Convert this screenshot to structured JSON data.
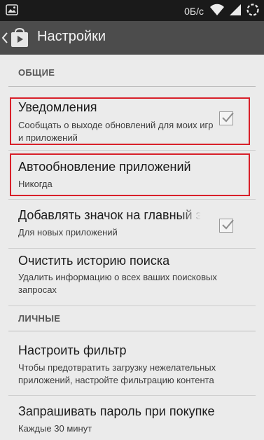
{
  "status_bar": {
    "data_rate": "0Б/с",
    "icons": [
      "image-icon",
      "wifi-icon",
      "signal-icon"
    ]
  },
  "action_bar": {
    "title": "Настройки",
    "icons": [
      "back-icon",
      "play-store-icon"
    ]
  },
  "sections": [
    {
      "header": "ОБЩИЕ",
      "items": [
        {
          "title": "Уведомления",
          "subtitle": "Сообщать о выходе обновлений для моих игр и приложений",
          "checkbox": true,
          "checked": true,
          "highlighted": true
        },
        {
          "title": "Автообновление приложений",
          "subtitle": "Никогда",
          "checkbox": false,
          "highlighted": true
        },
        {
          "title": "Добавлять значок на главный экр",
          "subtitle": "Для новых приложений",
          "checkbox": true,
          "checked": true,
          "highlighted": false
        },
        {
          "title": "Очистить историю поиска",
          "subtitle": "Удалить информацию о всех ваших поисковых запросах",
          "checkbox": false,
          "highlighted": false
        }
      ]
    },
    {
      "header": "ЛИЧНЫЕ",
      "items": [
        {
          "title": "Настроить фильтр",
          "subtitle": "Чтобы предотвратить загрузку нежелательных приложений, настройте фильтрацию контента",
          "checkbox": false,
          "highlighted": false
        },
        {
          "title": "Запрашивать пароль при покупке",
          "subtitle": "Каждые 30 минут",
          "checkbox": false,
          "highlighted": false
        }
      ]
    }
  ],
  "colors": {
    "status_bar": "#1a1a1a",
    "action_bar": "#4c4c4c",
    "background": "#ebebeb",
    "highlight_border": "#d8202a"
  }
}
